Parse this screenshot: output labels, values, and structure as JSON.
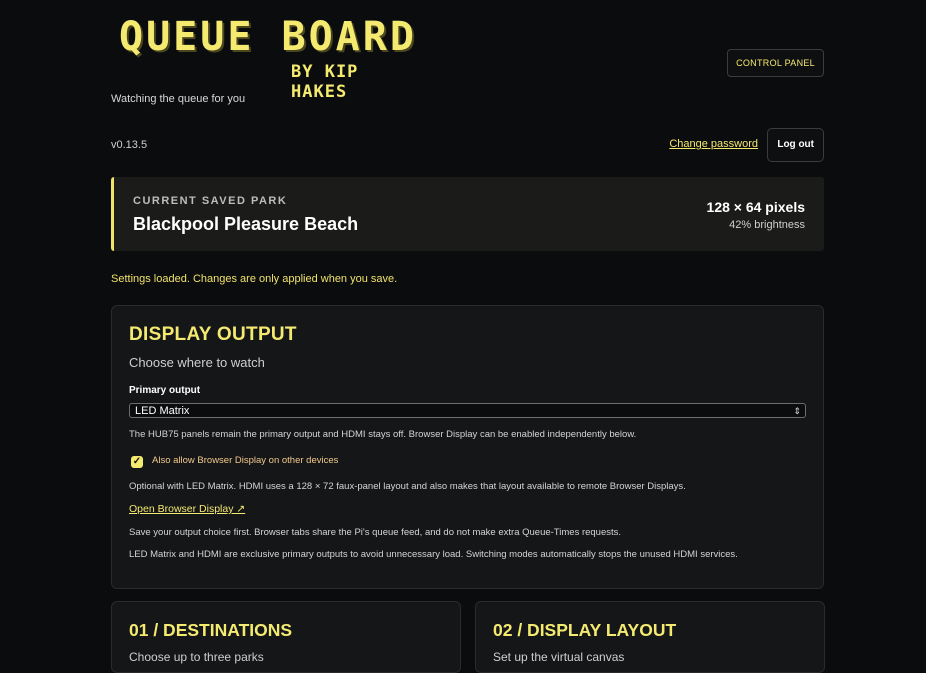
{
  "header": {
    "logo_title": "QUEUE BOARD",
    "logo_byline": "BY KIP HAKES",
    "tagline": "Watching the queue for you",
    "control_panel_label": "CONTROL PANEL"
  },
  "account": {
    "version": "v0.13.5",
    "change_password_label": "Change password",
    "logout_label": "Log out"
  },
  "park": {
    "label": "CURRENT SAVED PARK",
    "name": "Blackpool Pleasure Beach",
    "resolution": "128 × 64 pixels",
    "brightness": "42% brightness"
  },
  "status_message": "Settings loaded. Changes are only applied when you save.",
  "display_output": {
    "title": "DISPLAY OUTPUT",
    "subtitle": "Choose where to watch",
    "primary_label": "Primary output",
    "primary_value": "LED Matrix",
    "note_primary": "The HUB75 panels remain the primary output and HDMI stays off. Browser Display can be enabled independently below.",
    "checkbox_label": "Also allow Browser Display on other devices",
    "checkbox_checked": true,
    "note_optional": "Optional with LED Matrix. HDMI uses a 128 × 72 faux-panel layout and also makes that layout available to remote Browser Displays.",
    "open_link_label": "Open Browser Display ↗",
    "note_save": "Save your output choice first. Browser tabs share the Pi's queue feed, and do not make extra Queue-Times requests.",
    "note_exclusive": "LED Matrix and HDMI are exclusive primary outputs to avoid unnecessary load. Switching modes automatically stops the unused HDMI services."
  },
  "cards": [
    {
      "title": "01 / DESTINATIONS",
      "subtitle": "Choose up to three parks"
    },
    {
      "title": "02 / DISPLAY LAYOUT",
      "subtitle": "Set up the virtual canvas"
    }
  ]
}
